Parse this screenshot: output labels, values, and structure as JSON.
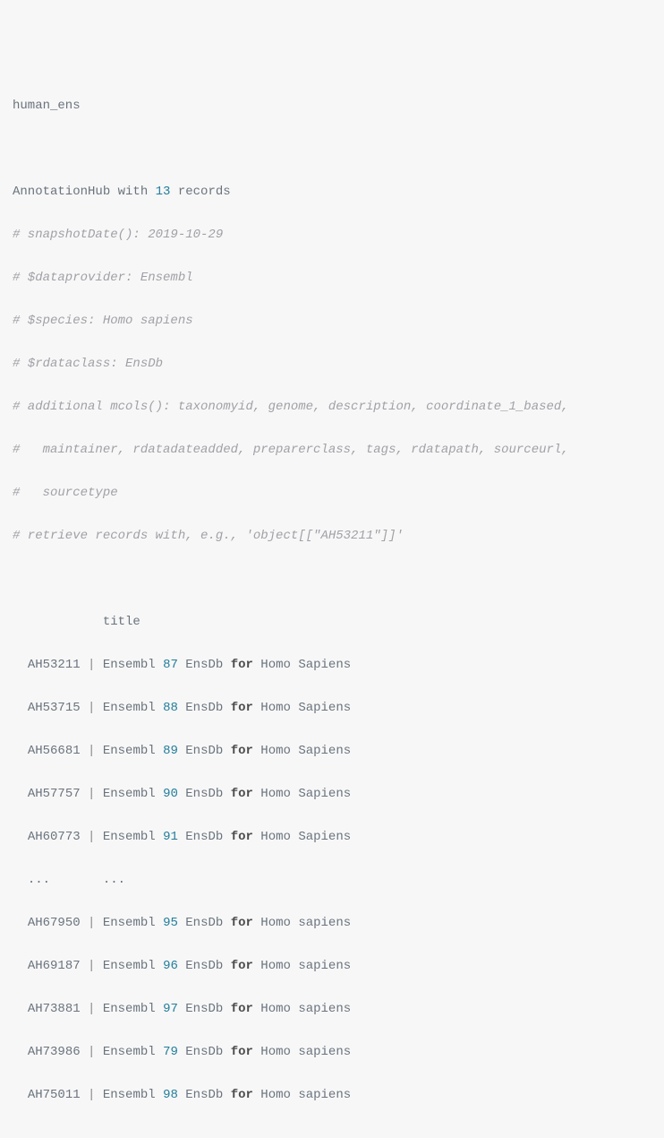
{
  "header": {
    "command": "human_ens",
    "summary_prefix": "AnnotationHub with ",
    "record_count": "13",
    "summary_suffix": " records"
  },
  "comments": [
    "# snapshotDate(): 2019-10-29",
    "# $dataprovider: Ensembl",
    "# $species: Homo sapiens",
    "# $rdataclass: EnsDb",
    "# additional mcols(): taxonomyid, genome, description, coordinate_1_based,",
    "#   maintainer, rdatadateadded, preparerclass, tags, rdatapath, sourceurl,",
    "#   sourcetype",
    "# retrieve records with, e.g., 'object[[\"AH53211\"]]'"
  ],
  "table": {
    "header_label": "title",
    "rows_top": [
      {
        "id": "AH53211",
        "prefix": "Ensembl ",
        "version": "87",
        "mid": " EnsDb ",
        "kw": "for",
        "suffix": " Homo Sapiens"
      },
      {
        "id": "AH53715",
        "prefix": "Ensembl ",
        "version": "88",
        "mid": " EnsDb ",
        "kw": "for",
        "suffix": " Homo Sapiens"
      },
      {
        "id": "AH56681",
        "prefix": "Ensembl ",
        "version": "89",
        "mid": " EnsDb ",
        "kw": "for",
        "suffix": " Homo Sapiens"
      },
      {
        "id": "AH57757",
        "prefix": "Ensembl ",
        "version": "90",
        "mid": " EnsDb ",
        "kw": "for",
        "suffix": " Homo Sapiens"
      },
      {
        "id": "AH60773",
        "prefix": "Ensembl ",
        "version": "91",
        "mid": " EnsDb ",
        "kw": "for",
        "suffix": " Homo Sapiens"
      }
    ],
    "ellipsis_left": "...",
    "ellipsis_right": "...",
    "rows_bottom": [
      {
        "id": "AH67950",
        "prefix": "Ensembl ",
        "version": "95",
        "mid": " EnsDb ",
        "kw": "for",
        "suffix": " Homo sapiens"
      },
      {
        "id": "AH69187",
        "prefix": "Ensembl ",
        "version": "96",
        "mid": " EnsDb ",
        "kw": "for",
        "suffix": " Homo sapiens"
      },
      {
        "id": "AH73881",
        "prefix": "Ensembl ",
        "version": "97",
        "mid": " EnsDb ",
        "kw": "for",
        "suffix": " Homo sapiens"
      },
      {
        "id": "AH73986",
        "prefix": "Ensembl ",
        "version": "79",
        "mid": " EnsDb ",
        "kw": "for",
        "suffix": " Homo sapiens"
      },
      {
        "id": "AH75011",
        "prefix": "Ensembl ",
        "version": "98",
        "mid": " EnsDb ",
        "kw": "for",
        "suffix": " Homo sapiens"
      }
    ]
  }
}
